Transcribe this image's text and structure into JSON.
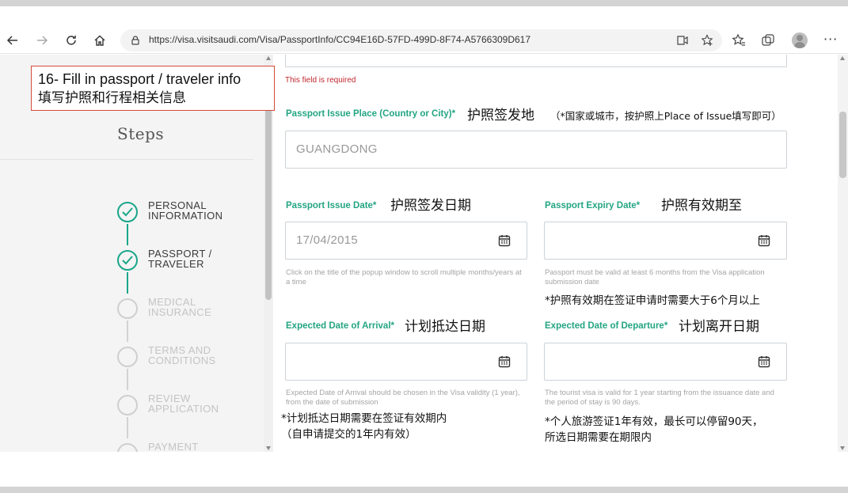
{
  "browser": {
    "url": "https://visa.visitsaudi.com/Visa/PassportInfo/CC94E16D-57FD-499D-8F74-A5766309D617",
    "icons": [
      "back-icon",
      "forward-icon",
      "refresh-icon",
      "home-icon",
      "lock-icon",
      "read-aloud-icon",
      "favorite-add-icon",
      "favorites-icon",
      "collections-icon",
      "profile-avatar",
      "more-icon"
    ],
    "more_label": "···"
  },
  "annotation": {
    "line1": "16- Fill in passport / traveler info",
    "line2": "填写护照和行程相关信息"
  },
  "sidebar": {
    "title": "Steps",
    "steps": [
      {
        "label": "PERSONAL INFORMATION",
        "status": "done"
      },
      {
        "label": "PASSPORT / TRAVELER",
        "status": "done"
      },
      {
        "label": "MEDICAL INSURANCE",
        "status": "pending"
      },
      {
        "label": "TERMS AND CONDITIONS",
        "status": "pending"
      },
      {
        "label": "REVIEW APPLICATION",
        "status": "pending"
      },
      {
        "label": "PAYMENT",
        "status": "pending"
      }
    ],
    "accent": "#1aa68a"
  },
  "form": {
    "error_text": "This field is required",
    "issue_place": {
      "label": "Passport Issue Place (Country or City)*",
      "note_main": "护照签发地",
      "note_sub": "（*国家或城市，按护照上Place of Issue填写即可）",
      "value": "GUANGDONG"
    },
    "issue_date": {
      "label": "Passport Issue Date*",
      "note": "护照签发日期",
      "value": "17/04/2015",
      "help": "Click on the title of the popup window to scroll multiple months/years at a time"
    },
    "expiry_date": {
      "label": "Passport Expiry Date*",
      "note": "护照有效期至",
      "value": "",
      "help": "Passport must be valid at least 6 months from the Visa application submission date",
      "cn_note": "*护照有效期在签证申请时需要大于6个月以上"
    },
    "arrival_date": {
      "label": "Expected Date of Arrival*",
      "note": "计划抵达日期",
      "value": "",
      "help": "Expected Date of Arrival should be chosen in the Visa validity (1 year), from the date of submission",
      "cn_note1": "*计划抵达日期需要在签证有效期内",
      "cn_note2": "（自申请提交的1年内有效）"
    },
    "departure_date": {
      "label": "Expected Date of Departure*",
      "note": "计划离开日期",
      "value": "",
      "help": "The tourist visa is valid for 1 year starting from the issuance date and the period of stay is 90 days.",
      "cn_note1": "*个人旅游签证1年有效，最长可以停留90天，",
      "cn_note2": "所选日期需要在期限内"
    },
    "label_color": "#23a583",
    "error_color": "#c1272d"
  }
}
